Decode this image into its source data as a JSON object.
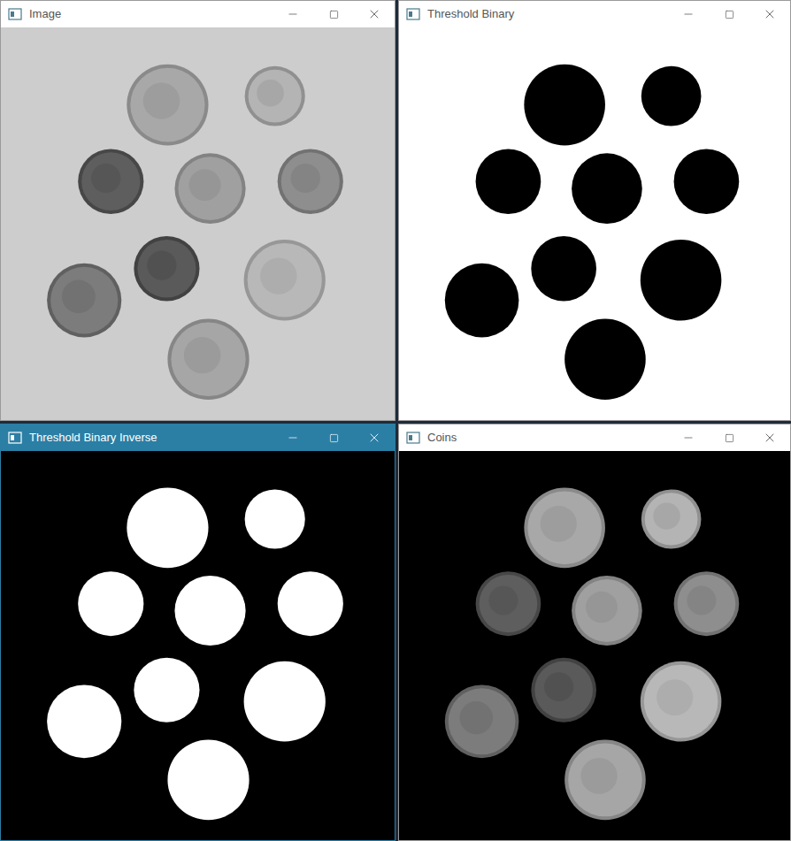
{
  "windows": [
    {
      "title": "Image",
      "active": false,
      "kind": "original"
    },
    {
      "title": "Threshold Binary",
      "active": false,
      "kind": "binary"
    },
    {
      "title": "Threshold Binary Inverse",
      "active": true,
      "kind": "binary-inverse"
    },
    {
      "title": "Coins",
      "active": false,
      "kind": "masked"
    }
  ]
}
